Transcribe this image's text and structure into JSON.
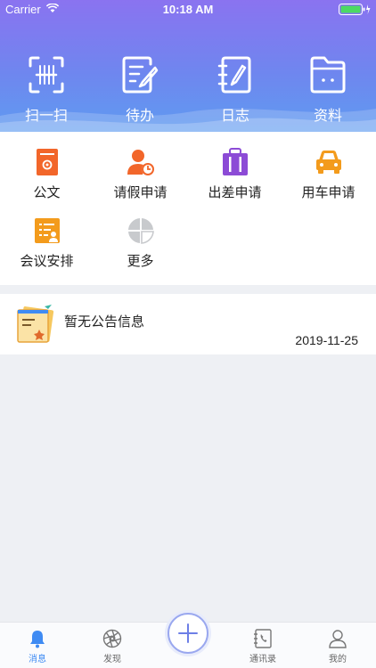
{
  "status_bar": {
    "carrier": "Carrier",
    "time": "10:18 AM"
  },
  "quick_actions": [
    {
      "label": "扫一扫",
      "icon": "scan-icon"
    },
    {
      "label": "待办",
      "icon": "todo-icon"
    },
    {
      "label": "日志",
      "icon": "log-icon"
    },
    {
      "label": "资料",
      "icon": "folder-icon"
    }
  ],
  "apps": [
    {
      "label": "公文",
      "icon": "document-icon",
      "color": "#f2662a"
    },
    {
      "label": "请假申请",
      "icon": "leave-request-icon",
      "color": "#f2662a"
    },
    {
      "label": "出差申请",
      "icon": "business-trip-icon",
      "color": "#8c4bd6"
    },
    {
      "label": "用车申请",
      "icon": "car-request-icon",
      "color": "#f39b1c"
    },
    {
      "label": "会议安排",
      "icon": "meeting-icon",
      "color": "#f39b1c"
    },
    {
      "label": "更多",
      "icon": "more-icon",
      "color": "#c8cacd"
    }
  ],
  "notice": {
    "title": "暂无公告信息",
    "date": "2019-11-25",
    "icon": "notice-board-icon"
  },
  "tabbar": [
    {
      "label": "消息",
      "icon": "bell-icon",
      "active": true
    },
    {
      "label": "发现",
      "icon": "aperture-icon",
      "active": false
    },
    {
      "label": "通讯录",
      "icon": "contacts-icon",
      "active": false
    },
    {
      "label": "我的",
      "icon": "user-icon",
      "active": false
    }
  ],
  "colors": {
    "accent": "#3f8bf3",
    "header_top": "#8a73f0",
    "header_bottom": "#5f9bf0"
  }
}
